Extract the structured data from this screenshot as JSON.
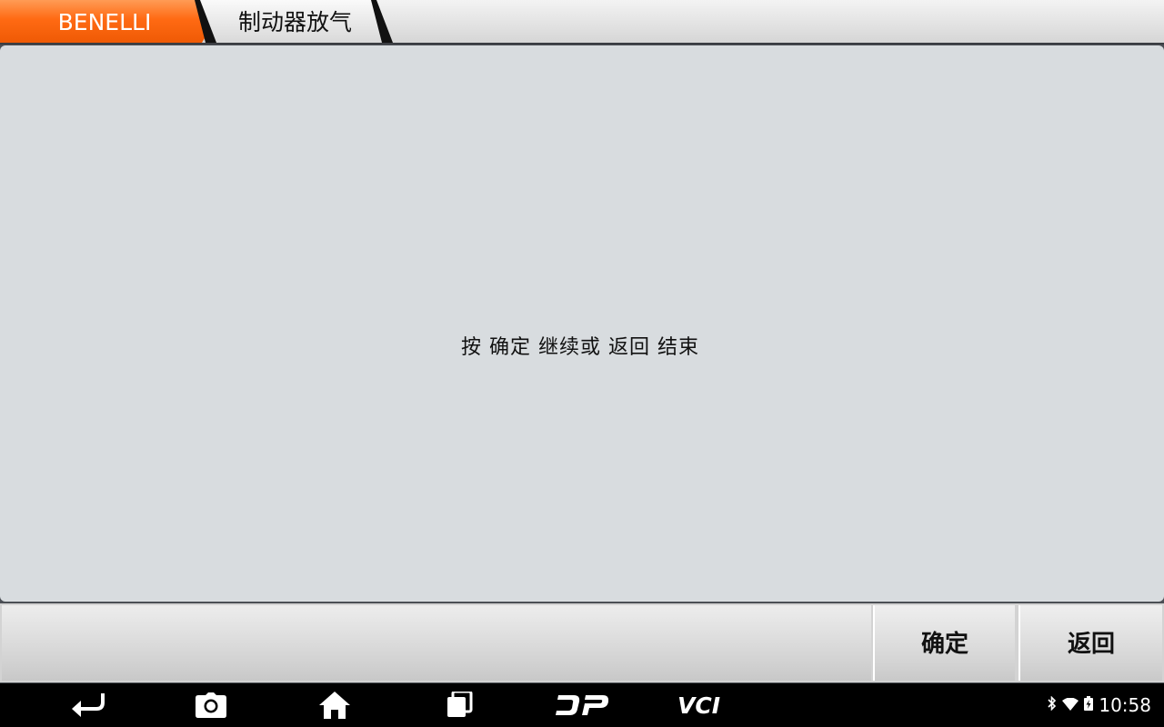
{
  "breadcrumb": {
    "items": [
      {
        "label": "BENELLI",
        "color": "#ff6a13"
      },
      {
        "label": "制动器放气"
      }
    ]
  },
  "main": {
    "message": "按 确定 继续或 返回 结束"
  },
  "actions": {
    "ok_label": "确定",
    "back_label": "返回"
  },
  "navbar": {
    "icons": [
      "back-icon",
      "screenshot-icon",
      "home-icon",
      "recent-apps-icon",
      "dp-icon",
      "vci-icon"
    ],
    "dp_label": "DP",
    "vci_label": "VCI"
  },
  "status": {
    "icons": [
      "bluetooth-icon",
      "wifi-icon",
      "battery-icon"
    ],
    "time": "10:58"
  }
}
